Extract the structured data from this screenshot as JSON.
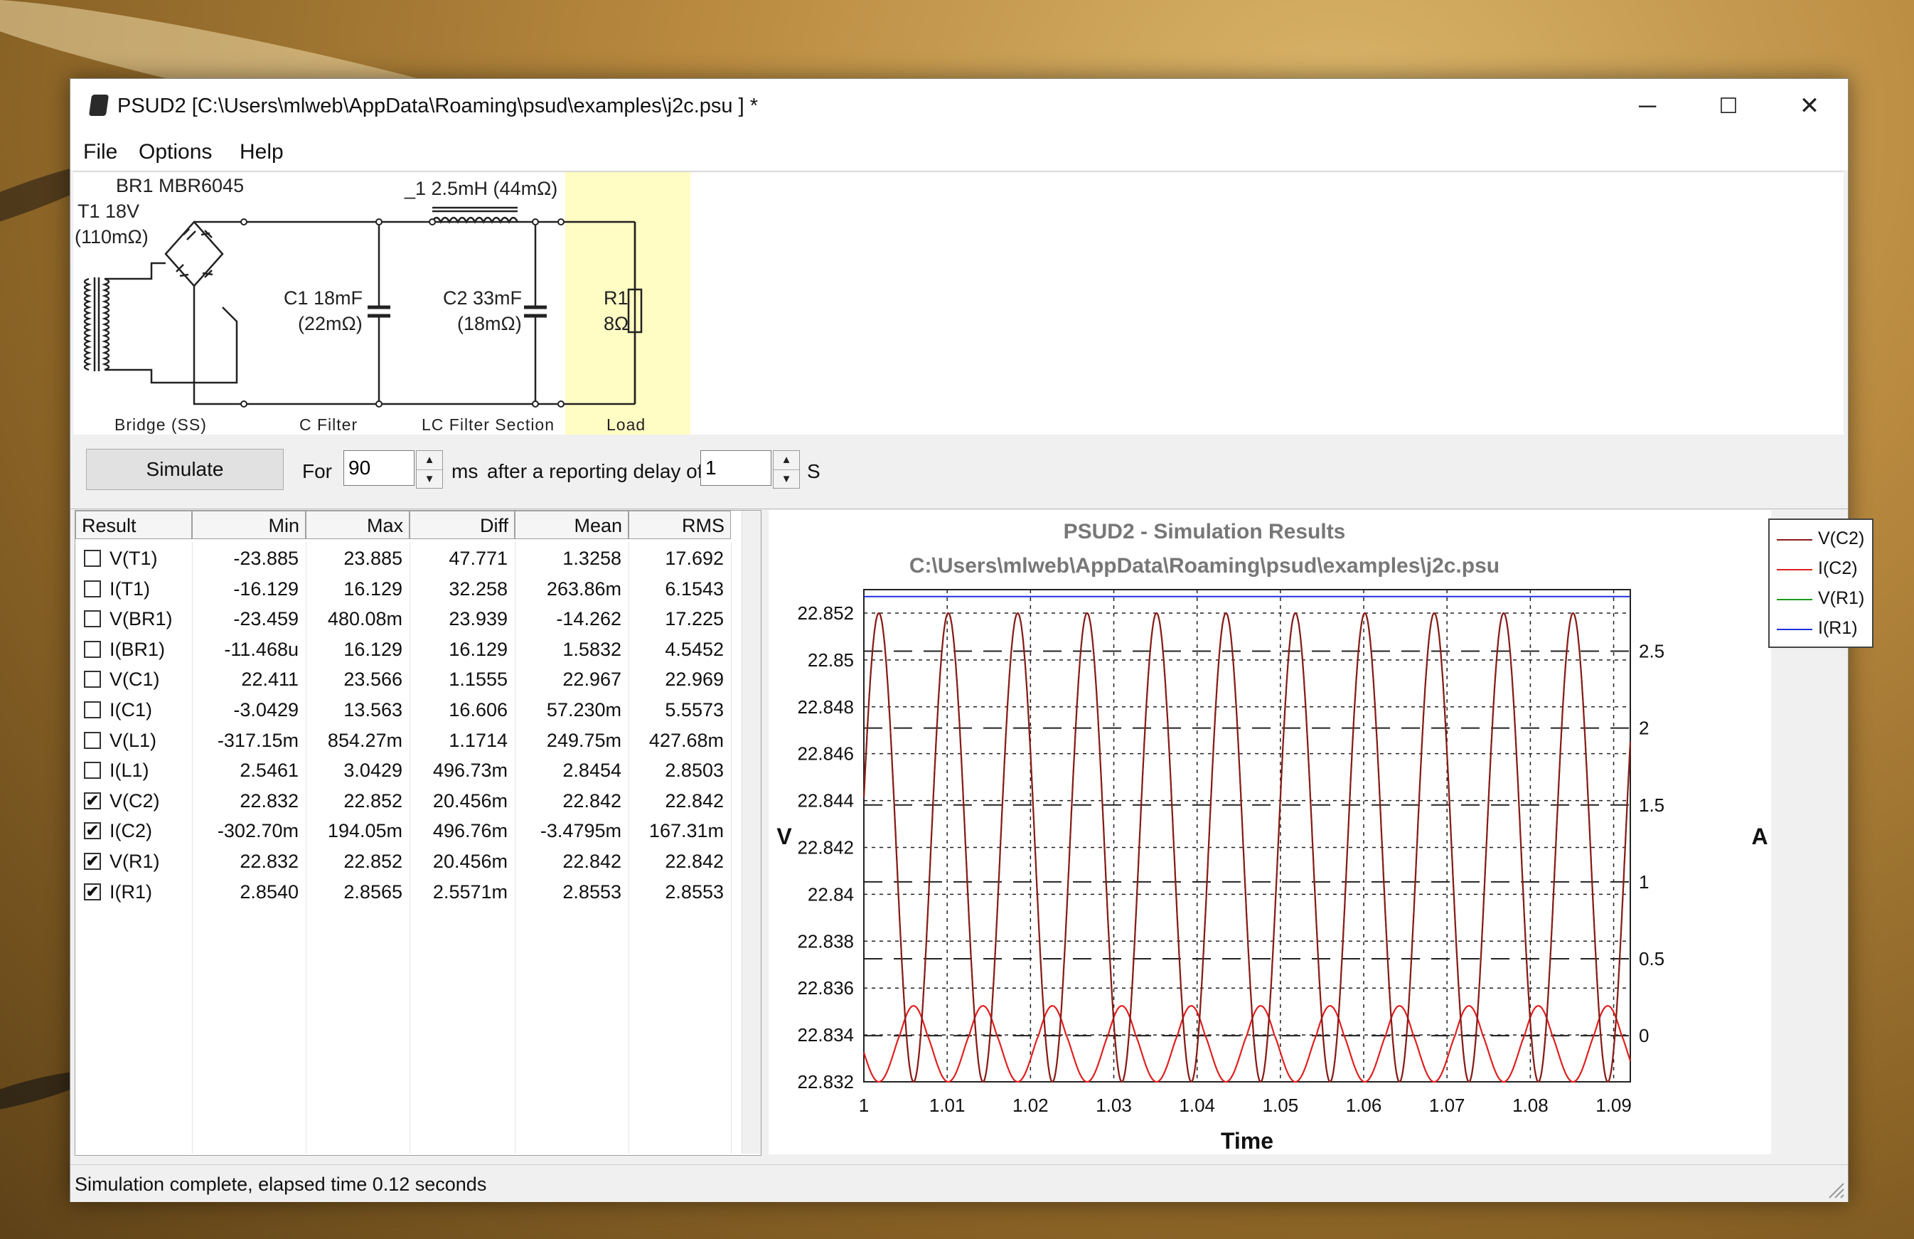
{
  "window": {
    "title": "PSUD2  [C:\\Users\\mlweb\\AppData\\Roaming\\psud\\examples\\j2c.psu ] *",
    "minimize_glyph": "─",
    "maximize_glyph": "☐",
    "close_glyph": "✕"
  },
  "menu": {
    "file": "File",
    "options": "Options",
    "help": "Help"
  },
  "schematic": {
    "bridge_label": "BR1 MBR6045",
    "transformer_label": "T1 18V",
    "transformer_res": "(110mΩ)",
    "inductor_label": "_1 2.5mH (44mΩ)",
    "c1_label": "C1 18mF",
    "c1_res": "(22mΩ)",
    "c2_label": "C2 33mF",
    "c2_res": "(18mΩ)",
    "r1_label": "R1",
    "r1_value": "8Ω",
    "section_bridge": "Bridge (SS)",
    "section_cfilter": "C Filter",
    "section_lc": "LC Filter Section",
    "section_load": "Load"
  },
  "controls": {
    "simulate_label": "Simulate",
    "for_label": "For",
    "duration_value": "90",
    "ms_label": "ms",
    "delay_label": "after a reporting delay of",
    "delay_value": "1",
    "s_label": "S"
  },
  "results": {
    "headers": [
      "Result",
      "Min",
      "Max",
      "Diff",
      "Mean",
      "RMS"
    ],
    "rows": [
      {
        "checked": false,
        "name": "V(T1)",
        "min": "-23.885",
        "max": "23.885",
        "diff": "47.771",
        "mean": "1.3258",
        "rms": "17.692"
      },
      {
        "checked": false,
        "name": "I(T1)",
        "min": "-16.129",
        "max": "16.129",
        "diff": "32.258",
        "mean": "263.86m",
        "rms": "6.1543"
      },
      {
        "checked": false,
        "name": "V(BR1)",
        "min": "-23.459",
        "max": "480.08m",
        "diff": "23.939",
        "mean": "-14.262",
        "rms": "17.225"
      },
      {
        "checked": false,
        "name": "I(BR1)",
        "min": "-11.468u",
        "max": "16.129",
        "diff": "16.129",
        "mean": "1.5832",
        "rms": "4.5452"
      },
      {
        "checked": false,
        "name": "V(C1)",
        "min": "22.411",
        "max": "23.566",
        "diff": "1.1555",
        "mean": "22.967",
        "rms": "22.969"
      },
      {
        "checked": false,
        "name": "I(C1)",
        "min": "-3.0429",
        "max": "13.563",
        "diff": "16.606",
        "mean": "57.230m",
        "rms": "5.5573"
      },
      {
        "checked": false,
        "name": "V(L1)",
        "min": "-317.15m",
        "max": "854.27m",
        "diff": "1.1714",
        "mean": "249.75m",
        "rms": "427.68m"
      },
      {
        "checked": false,
        "name": "I(L1)",
        "min": "2.5461",
        "max": "3.0429",
        "diff": "496.73m",
        "mean": "2.8454",
        "rms": "2.8503"
      },
      {
        "checked": true,
        "name": "V(C2)",
        "min": "22.832",
        "max": "22.852",
        "diff": "20.456m",
        "mean": "22.842",
        "rms": "22.842"
      },
      {
        "checked": true,
        "name": "I(C2)",
        "min": "-302.70m",
        "max": "194.05m",
        "diff": "496.76m",
        "mean": "-3.4795m",
        "rms": "167.31m"
      },
      {
        "checked": true,
        "name": "V(R1)",
        "min": "22.832",
        "max": "22.852",
        "diff": "20.456m",
        "mean": "22.842",
        "rms": "22.842"
      },
      {
        "checked": true,
        "name": "I(R1)",
        "min": "2.8540",
        "max": "2.8565",
        "diff": "2.5571m",
        "mean": "2.8553",
        "rms": "2.8553"
      }
    ]
  },
  "chart_data": {
    "type": "line",
    "title": "PSUD2 - Simulation Results",
    "subtitle": "C:\\Users\\mlweb\\AppData\\Roaming\\psud\\examples\\j2c.psu",
    "xlabel": "Time",
    "ylabel_left": "V",
    "ylabel_right": "A",
    "xlim": [
      1.0,
      1.092
    ],
    "ylim_left": [
      22.832,
      22.853
    ],
    "ylim_right": [
      -0.3,
      2.9
    ],
    "x_ticks": [
      "1",
      "1.01",
      "1.02",
      "1.03",
      "1.04",
      "1.05",
      "1.06",
      "1.07",
      "1.08",
      "1.09"
    ],
    "y_left_ticks": [
      "22.852",
      "22.85",
      "22.848",
      "22.846",
      "22.844",
      "22.842",
      "22.84",
      "22.838",
      "22.836",
      "22.834",
      "22.832"
    ],
    "y_right_ticks": [
      "2.5",
      "2",
      "1.5",
      "1",
      "0.5",
      "0"
    ],
    "ripple_period": 0.008333,
    "legend": [
      "V(C2)",
      "I(C2)",
      "V(R1)",
      "I(R1)"
    ],
    "series": [
      {
        "name": "V(C2)",
        "axis": "left",
        "color": "#8b1a1a",
        "min": 22.832,
        "max": 22.852
      },
      {
        "name": "I(C2)",
        "axis": "right",
        "color": "#e02020",
        "min": -0.3027,
        "max": 0.19405
      },
      {
        "name": "V(R1)",
        "axis": "left",
        "color": "#1e9b1e",
        "min": 22.832,
        "max": 22.852
      },
      {
        "name": "I(R1)",
        "axis": "right",
        "color": "#2030e0",
        "min": 2.854,
        "max": 2.8565
      }
    ],
    "grid": true,
    "legend_position": "right"
  },
  "status": {
    "text": "Simulation complete, elapsed time 0.12 seconds"
  }
}
